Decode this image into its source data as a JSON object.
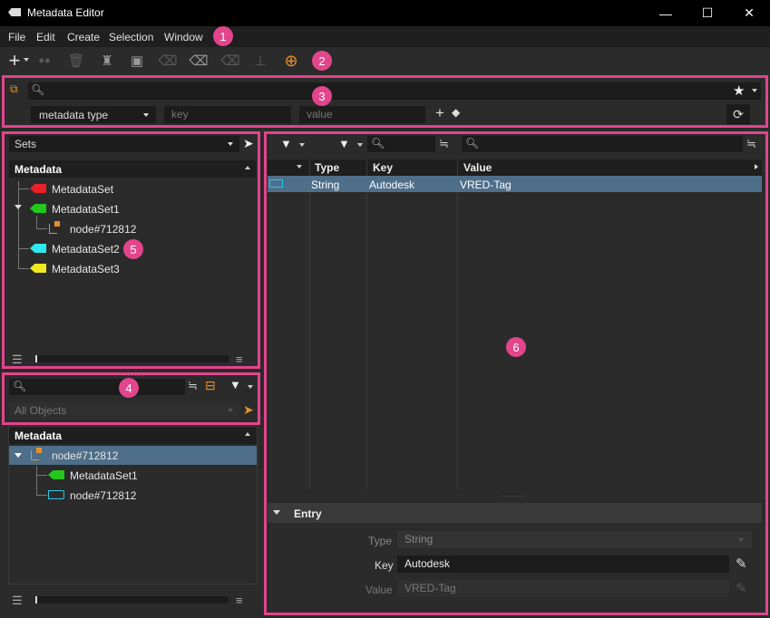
{
  "window": {
    "title": "Metadata Editor",
    "minimize": "—",
    "maximize": "☐",
    "close": "✕"
  },
  "menubar": [
    "File",
    "Edit",
    "Create",
    "Selection",
    "Window"
  ],
  "badges": [
    "1",
    "2",
    "3",
    "4",
    "5",
    "6"
  ],
  "toolbar": {
    "icons": [
      "add-icon",
      "link-icon",
      "delete-icon",
      "assign-icon",
      "remove-icon",
      "untag-icon",
      "tag-remove-icon",
      "tag-clear-icon",
      "clean-icon",
      "target-icon"
    ]
  },
  "search": {
    "type_combo": "metadata type",
    "key_placeholder": "key",
    "value_placeholder": "value"
  },
  "sets_panel": {
    "combo": "Sets",
    "header": "Metadata",
    "items": [
      {
        "label": "MetadataSet",
        "color": "#e8202a"
      },
      {
        "label": "MetadataSet1",
        "color": "#22c81e"
      },
      {
        "label": "node#712812",
        "color": "#e8902a"
      },
      {
        "label": "MetadataSet2",
        "color": "#2ee8f0"
      },
      {
        "label": "MetadataSet3",
        "color": "#f0e81e"
      }
    ]
  },
  "objects_panel": {
    "combo": "All Objects",
    "header": "Metadata",
    "items": [
      {
        "label": "node#712812"
      },
      {
        "label": "MetadataSet1",
        "color": "#22c81e"
      },
      {
        "label": "node#712812"
      }
    ]
  },
  "entries": {
    "columns": [
      "Type",
      "Key",
      "Value"
    ],
    "rows": [
      {
        "type": "String",
        "key": "Autodesk",
        "value": "VRED-Tag"
      }
    ]
  },
  "entry_section": {
    "title": "Entry",
    "type_label": "Type",
    "type_value": "String",
    "key_label": "Key",
    "key_value": "Autodesk",
    "value_label": "Value",
    "value_value": "VRED-Tag"
  },
  "colors": {
    "accent": "#e2458b",
    "selection": "#4e6e8a"
  }
}
